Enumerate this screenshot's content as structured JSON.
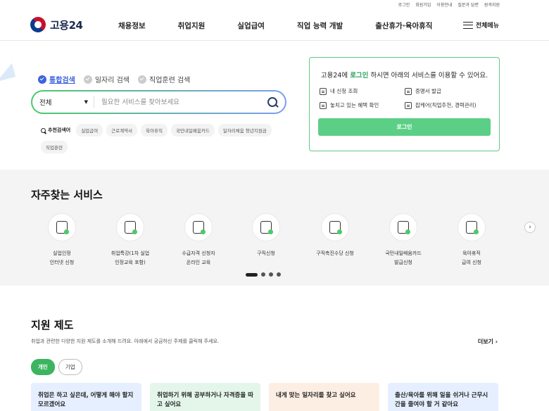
{
  "util_links": [
    "로그인",
    "회원가입",
    "이용안내",
    "질문과 답변",
    "원격지원"
  ],
  "logo": {
    "text": "고용24"
  },
  "gnb": [
    "채용정보",
    "취업지원",
    "실업급여",
    "직업 능력 개발",
    "출산휴가·육아휴직"
  ],
  "all_menu": "전체메뉴",
  "search_tabs": [
    {
      "label": "통합검색",
      "active": true
    },
    {
      "label": "일자리 검색",
      "active": false
    },
    {
      "label": "직업훈련 검색",
      "active": false
    }
  ],
  "search": {
    "select_value": "전체",
    "placeholder": "필요한 서비스를 찾아보세요"
  },
  "recommend": {
    "label": "추천검색어",
    "chips": [
      "실업급여",
      "근로계약서",
      "육아휴직",
      "국민내일배움카드",
      "일자리채움 청년지원금",
      "직업훈련"
    ]
  },
  "login_box": {
    "title_pre": "고용24에 ",
    "title_link": "로그인",
    "title_post": " 하시면 아래의 서비스를 이용할 수 있어요.",
    "items": [
      "내 신청 조회",
      "증명서 발급",
      "놓치고 있는 혜택 확인",
      "잡케어(직업추천, 경력관리)"
    ],
    "button": "로그인"
  },
  "frequent": {
    "title": "자주찾는 서비스",
    "items": [
      {
        "label": "실업인정\n인터넷 신청",
        "icon": "document-edit-icon"
      },
      {
        "label": "취업특강(1차 실업\n인정교육 포함)",
        "icon": "presentation-board-icon"
      },
      {
        "label": "수급자격 신청자\n온라인 교육",
        "icon": "monitor-play-icon"
      },
      {
        "label": "구직신청",
        "icon": "person-edit-icon"
      },
      {
        "label": "구직촉진수당 신청",
        "icon": "money-bag-icon"
      },
      {
        "label": "국민내일배움카드\n발급신청",
        "icon": "card-icon"
      },
      {
        "label": "육아휴직\n급여 신청",
        "icon": "baby-bottle-icon"
      }
    ]
  },
  "support": {
    "title": "지원 제도",
    "desc": "취업과 관련한 다양한 지원 제도를 소개해 드려요. 아래에서 궁금하신 주제를 클릭해 주세요.",
    "more": "더보기 ›",
    "toggles": [
      {
        "label": "개인",
        "active": true
      },
      {
        "label": "기업",
        "active": false
      }
    ],
    "cards": [
      {
        "text": "취업은 하고 싶은데, 어떻게 해야 할지 모르겠어요",
        "color": "#e6efff"
      },
      {
        "text": "취업하기 위해 공부하거나 자격증을 따고 싶어요",
        "color": "#e4f6ea"
      },
      {
        "text": "내게 맞는 일자리를 찾고 싶어요",
        "color": "#fdeee4"
      },
      {
        "text": "출산/육아를 위해 일을 쉬거나 근무시간을 줄여야 할 거 같아요",
        "color": "#e6efff"
      }
    ]
  }
}
